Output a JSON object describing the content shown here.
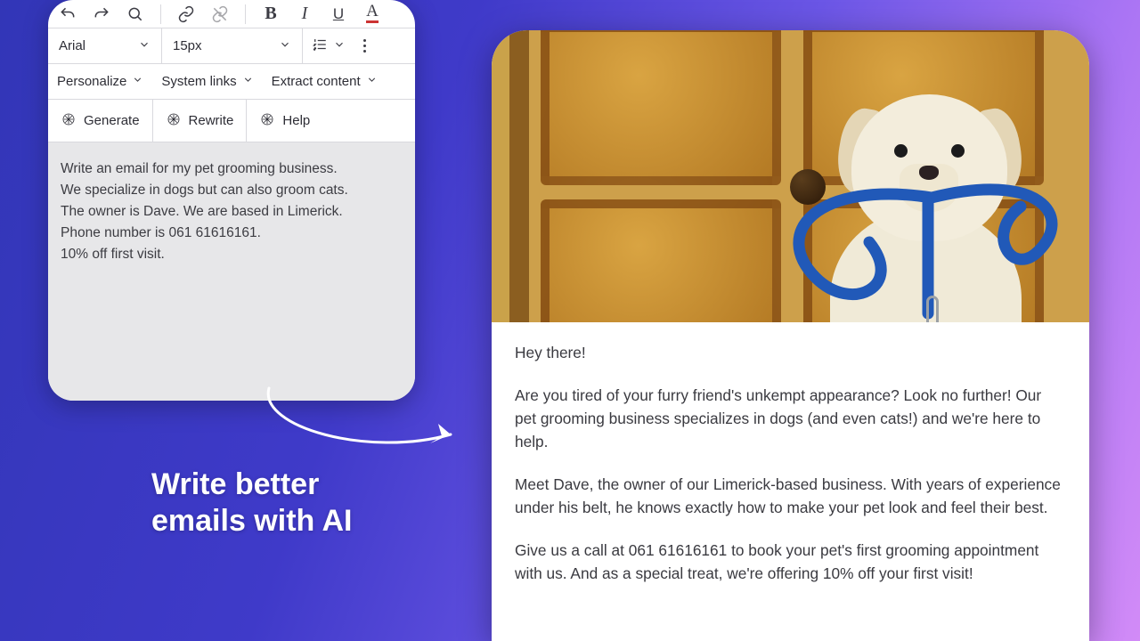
{
  "editor": {
    "font_family": "Arial",
    "font_size": "15px",
    "dropdowns": {
      "personalize": "Personalize",
      "system_links": "System links",
      "extract_content": "Extract content"
    },
    "ai_buttons": {
      "generate": "Generate",
      "rewrite": "Rewrite",
      "help": "Help"
    },
    "format_letters": {
      "bold": "B",
      "italic": "I",
      "underline": "U",
      "color": "A"
    },
    "body_text": "Write an email for my pet grooming business.\nWe specialize in dogs but can also groom cats.\nThe owner is Dave. We are based in Limerick.\nPhone number is 061 61616161.\n10% off first visit."
  },
  "tagline": {
    "line1": "Write better",
    "line2": "emails with AI"
  },
  "email_preview": {
    "greeting": "Hey there!",
    "p1": "Are you tired of your furry friend's unkempt appearance? Look no further! Our pet grooming business specializes in dogs (and even cats!) and we're here to help.",
    "p2": "Meet Dave, the owner of our Limerick-based business. With years of experience under his belt, he knows exactly how to make your pet look and feel their best.",
    "p3": "Give us a call at 061 61616161 to book your pet's first grooming appointment with us. And as a special treat, we're offering 10% off your first visit!"
  }
}
